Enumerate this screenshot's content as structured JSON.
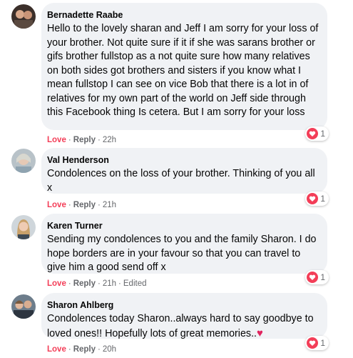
{
  "comments": [
    {
      "author": "Bernadette Raabe",
      "text": "Hello to the lovely sharan and Jeff I am sorry for your loss of your brother. Not quite sure if it if she was sarans brother or gifs brother fullstop as a not quite sure how many relatives on both sides got brothers and sisters if you know what I mean fullstop I can see on vice Bob that there is a lot in of relatives for my own part of the world on Jeff side through this Facebook thing Is cetera. But I am sorry for your loss",
      "love_label": "Love",
      "reply_label": "Reply",
      "time": "22h",
      "reaction_count": "1"
    },
    {
      "author": "Val Henderson",
      "text": "Condolences on the loss of your brother. Thinking of you all x",
      "love_label": "Love",
      "reply_label": "Reply",
      "time": "21h",
      "reaction_count": "1"
    },
    {
      "author": "Karen Turner",
      "text": "Sending my condolences to you and the family Sharon. I do hope borders are in your favour so that you can travel to give him a good send off x",
      "love_label": "Love",
      "reply_label": "Reply",
      "time": "21h",
      "edited": "Edited",
      "reaction_count": "1"
    },
    {
      "author": "Sharon Ahlberg",
      "text": "Condolences today Sharon..always hard to say goodbye to loved ones!! Hopefully lots of great memories..",
      "love_label": "Love",
      "reply_label": "Reply",
      "time": "20h",
      "reaction_count": "1"
    }
  ],
  "separator": "·",
  "colors": {
    "love": "#f33e58",
    "bubble": "#f0f2f5",
    "meta": "#65676b"
  },
  "icons": {
    "reaction": "heart-icon",
    "emoji": "red-heart-emoji"
  }
}
